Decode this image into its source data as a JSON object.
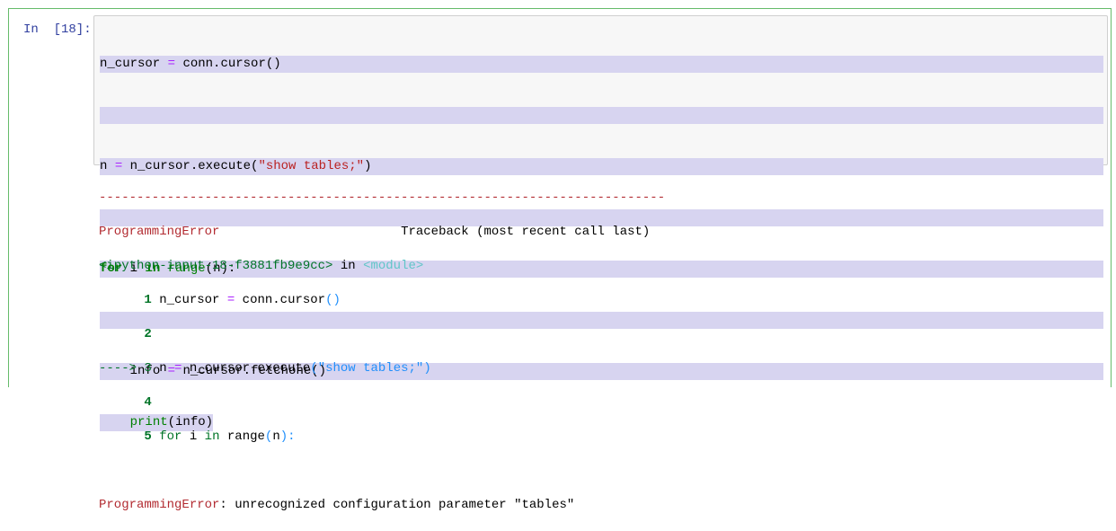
{
  "prompt": {
    "label": "In  [18]:"
  },
  "code": {
    "line1": {
      "var": "n_cursor",
      "op": "=",
      "rest": "conn.cursor()"
    },
    "line3": {
      "var": "n",
      "op": "=",
      "call": "n_cursor.execute(",
      "str": "\"show tables;\"",
      "close": ")"
    },
    "line5": {
      "kw_for": "for",
      "var": "i",
      "kw_in": "in",
      "fn": "range",
      "args": "(n):"
    },
    "line7": {
      "var": "info",
      "op": "=",
      "rest": "n_cursor.fetchone()"
    },
    "line8": {
      "fn": "print",
      "args": "(info)"
    }
  },
  "output": {
    "dashes": "---------------------------------------------------------------------------",
    "error_name": "ProgrammingError",
    "traceback_label": "Traceback (most recent call last)",
    "source": "<ipython-input-18-f3881fb9e9cc>",
    "in_word": "in",
    "module": "<module>",
    "tb1": {
      "num": "1",
      "code": "n_cursor",
      "op": "=",
      "rest": "conn.cursor",
      "paren": "()"
    },
    "tb2": {
      "num": "2"
    },
    "tb3": {
      "arrow": "---->",
      "num": "3",
      "code": "n",
      "op": "=",
      "call": "n_cursor.execute",
      "open": "(",
      "str": "\"show tables;\"",
      "close": ")"
    },
    "tb4": {
      "num": "4"
    },
    "tb5": {
      "num": "5",
      "kw_for": "for",
      "var": "i",
      "kw_in": "in",
      "fn": "range",
      "open": "(",
      "arg": "n",
      "close": "):"
    },
    "final_error_name": "ProgrammingError",
    "final_message": ": unrecognized configuration parameter \"tables\""
  }
}
